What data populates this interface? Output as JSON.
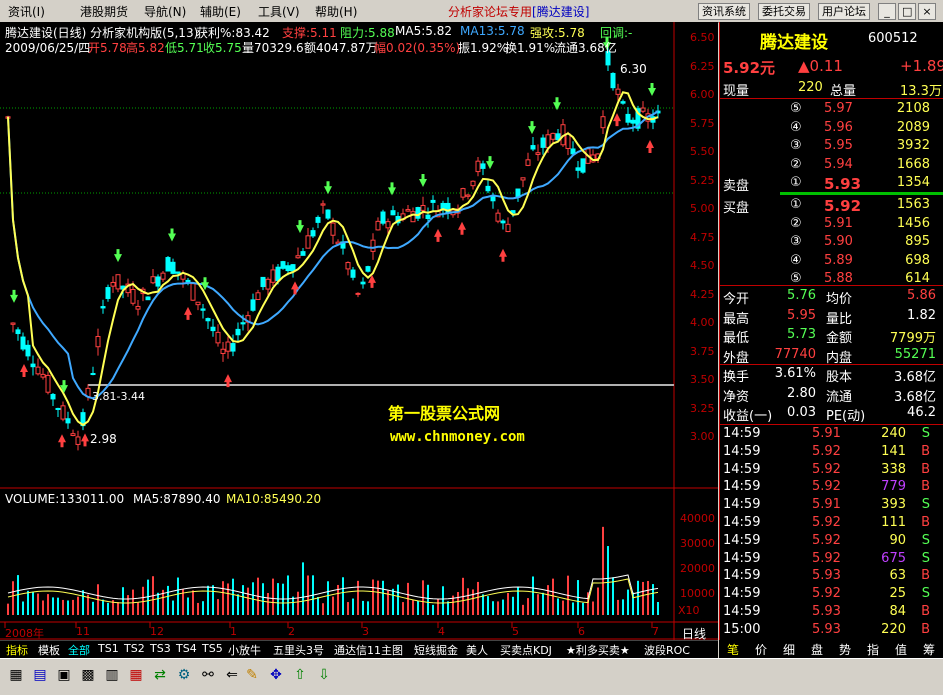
{
  "menu": {
    "items": [
      "资讯(I)",
      "港股期货",
      "导航(N)",
      "辅助(E)",
      "工具(V)",
      "帮助(H)"
    ],
    "forum_prefix": "分析家论坛专用",
    "forum_stock": "[腾达建设]",
    "buttons": [
      "资讯系统",
      "委托交易",
      "用户论坛"
    ]
  },
  "header": {
    "line1": {
      "title": "腾达建设(日线) 分析家机构版(5,13)",
      "profit": "获利%:83.42",
      "support": "支撑:5.11",
      "resist": "阻力:5.88",
      "ma5": "MA5:5.82",
      "ma13": "MA13:5.78",
      "strong": "强攻:5.78",
      "pullback": "回调:-"
    },
    "line2": {
      "date": "2009/06/25/四",
      "open": "开5.78",
      "high": "高5.82",
      "low": "低5.71",
      "close": "收5.75",
      "vol": "量70329.6",
      "amount": "额4047.87万",
      "range": "幅0.02(0.35%)",
      "amp": "振1.92%",
      "turn": "换1.91%",
      "float": "流通3.68亿"
    }
  },
  "price_axis": [
    "6.50",
    "6.25",
    "6.00",
    "5.75",
    "5.50",
    "5.25",
    "5.00",
    "4.75",
    "4.50",
    "4.25",
    "4.00",
    "3.75",
    "3.50",
    "3.25",
    "3.00"
  ],
  "annotations": {
    "high": "6.30",
    "low": "2.98",
    "line": "3.81-3.44",
    "watermark_cn": "第一股票公式网",
    "watermark_url": "www.chnmoney.com"
  },
  "volume_panel": {
    "vol": "VOLUME:133011.00",
    "ma5": "MA5:87890.40",
    "ma10": "MA10:85490.20",
    "axis": [
      "40000",
      "30000",
      "20000",
      "10000"
    ],
    "unit": "X10"
  },
  "time_axis": {
    "labels": [
      "2008年",
      "11",
      "12",
      "1",
      "2",
      "3",
      "4",
      "5",
      "6",
      "7"
    ],
    "period": "日线"
  },
  "quote": {
    "name": "腾达建设",
    "code": "600512",
    "price": "5.92元",
    "change": "▲0.11",
    "pct": "+1.89",
    "now_vol_label": "现量",
    "now_vol": "220",
    "total_vol_label": "总量",
    "total_vol": "13.3万",
    "sells": [
      {
        "lvl": "⑤",
        "price": "5.97",
        "vol": "2108"
      },
      {
        "lvl": "④",
        "price": "5.96",
        "vol": "2089"
      },
      {
        "lvl": "③",
        "price": "5.95",
        "vol": "3932"
      },
      {
        "lvl": "②",
        "price": "5.94",
        "vol": "1668"
      },
      {
        "lvl": "①",
        "price": "5.93",
        "vol": "1354"
      }
    ],
    "sell_label": "卖盘",
    "buy_label": "买盘",
    "buys": [
      {
        "lvl": "①",
        "price": "5.92",
        "vol": "1563"
      },
      {
        "lvl": "②",
        "price": "5.91",
        "vol": "1456"
      },
      {
        "lvl": "③",
        "price": "5.90",
        "vol": "895"
      },
      {
        "lvl": "④",
        "price": "5.89",
        "vol": "698"
      },
      {
        "lvl": "⑤",
        "price": "5.88",
        "vol": "614"
      }
    ],
    "stats": [
      {
        "l1": "今开",
        "v1": "5.76",
        "l2": "均价",
        "v2": "5.86"
      },
      {
        "l1": "最高",
        "v1": "5.95",
        "l2": "量比",
        "v2": "1.82"
      },
      {
        "l1": "最低",
        "v1": "5.73",
        "l2": "金额",
        "v2": "7799万"
      },
      {
        "l1": "外盘",
        "v1": "77740",
        "l2": "内盘",
        "v2": "55271"
      }
    ],
    "stats2": [
      {
        "l1": "换手",
        "v1": "3.61%",
        "l2": "股本",
        "v2": "3.68亿"
      },
      {
        "l1": "净资",
        "v1": "2.80",
        "l2": "流通",
        "v2": "3.68亿"
      },
      {
        "l1": "收益(一)",
        "v1": "0.03",
        "l2": "PE(动)",
        "v2": "46.2"
      }
    ],
    "ticks": [
      {
        "t": "14:59",
        "p": "5.91",
        "v": "240",
        "s": "S"
      },
      {
        "t": "14:59",
        "p": "5.92",
        "v": "141",
        "s": "B"
      },
      {
        "t": "14:59",
        "p": "5.92",
        "v": "338",
        "s": "B"
      },
      {
        "t": "14:59",
        "p": "5.92",
        "v": "779",
        "s": "B"
      },
      {
        "t": "14:59",
        "p": "5.91",
        "v": "393",
        "s": "S"
      },
      {
        "t": "14:59",
        "p": "5.92",
        "v": "111",
        "s": "B"
      },
      {
        "t": "14:59",
        "p": "5.92",
        "v": "90",
        "s": "S"
      },
      {
        "t": "14:59",
        "p": "5.92",
        "v": "675",
        "s": "S"
      },
      {
        "t": "14:59",
        "p": "5.93",
        "v": "63",
        "s": "B"
      },
      {
        "t": "14:59",
        "p": "5.92",
        "v": "25",
        "s": "S"
      },
      {
        "t": "14:59",
        "p": "5.93",
        "v": "84",
        "s": "B"
      },
      {
        "t": "15:00",
        "p": "5.93",
        "v": "220",
        "s": "B"
      }
    ]
  },
  "bottom_tabs": [
    "指标",
    "模板",
    "全部",
    "TS1",
    "TS2",
    "TS3",
    "TS4",
    "TS5",
    "小放牛",
    "五里头3号",
    "通达信11主图",
    "短线掘金",
    "美人",
    "买卖点KDJ",
    "★利多买卖★",
    "波段ROC"
  ],
  "right_tabs": [
    "笔",
    "价",
    "细",
    "盘",
    "势",
    "指",
    "值",
    "筹"
  ],
  "colors": {
    "up": "#ff4040",
    "down": "#54ff54",
    "ma5": "#ffff54",
    "ma13": "#3fa9ff",
    "axis": "#c00000"
  }
}
